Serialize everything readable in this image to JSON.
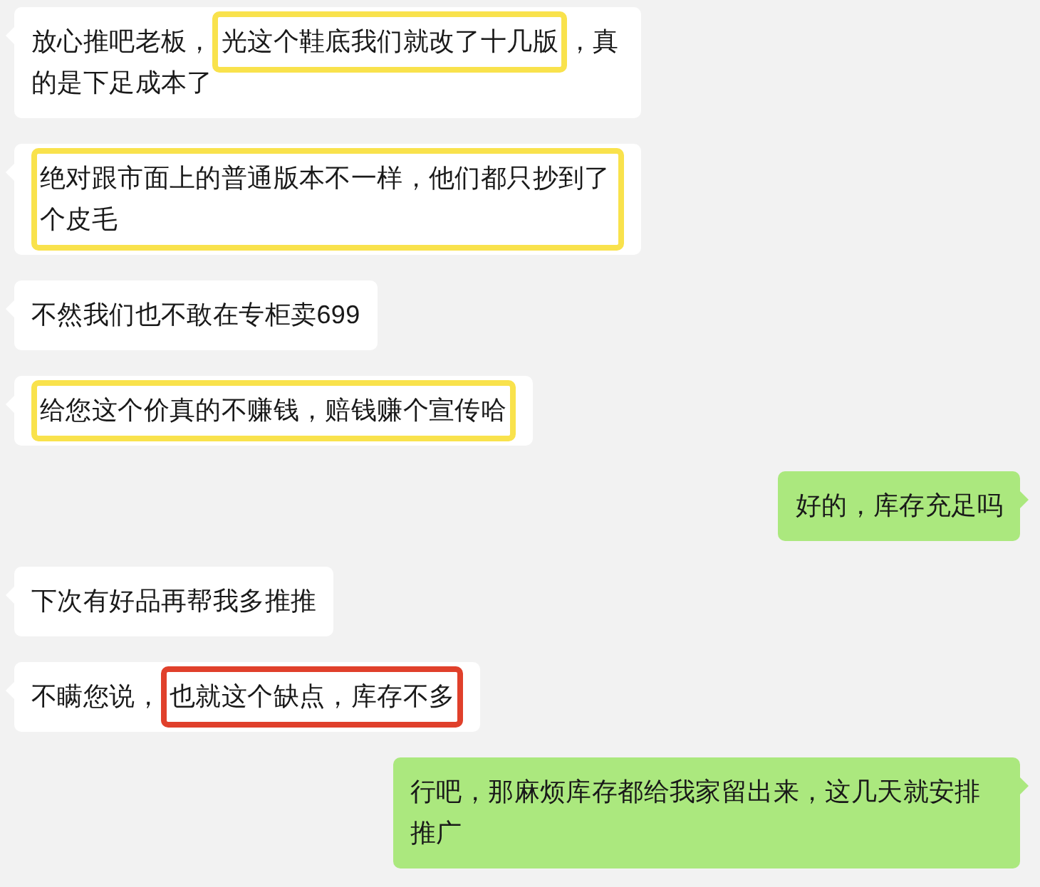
{
  "messages": [
    {
      "kind": "received",
      "segments": [
        {
          "text": "放心推吧老板，",
          "highlighted": false
        },
        {
          "text": "光这个鞋底我们就改了十几版",
          "highlighted": true,
          "color": "#f9e24c"
        },
        {
          "text": "，真",
          "highlighted": false
        },
        {
          "text": "的是下足成本了",
          "highlighted": false
        }
      ]
    },
    {
      "kind": "received",
      "segments": [
        {
          "text": "绝对跟市面上的普通版本不一样，他们都只抄到了个皮毛",
          "highlighted": true,
          "color": "#f9e24c"
        }
      ]
    },
    {
      "kind": "received",
      "segments": [
        {
          "text": "不然我们也不敢在专柜卖699",
          "highlighted": false
        }
      ]
    },
    {
      "kind": "received",
      "segments": [
        {
          "text": "给您这个价真的不赚钱，赔钱赚个宣传哈",
          "highlighted": true,
          "color": "#f9e24c"
        }
      ]
    },
    {
      "kind": "sent",
      "segments": [
        {
          "text": "好的，库存充足吗",
          "highlighted": false
        }
      ]
    },
    {
      "kind": "received",
      "segments": [
        {
          "text": "下次有好品再帮我多推推",
          "highlighted": false
        }
      ]
    },
    {
      "kind": "received",
      "segments": [
        {
          "text": "不瞒您说，",
          "highlighted": false
        },
        {
          "text": "也就这个缺点，库存不多",
          "highlighted": true,
          "color": "#e0402b"
        }
      ]
    },
    {
      "kind": "sent",
      "segments": [
        {
          "text": "行吧，那麻烦库存都给我家留出来，这几天就安排推广",
          "highlighted": false
        }
      ]
    }
  ]
}
